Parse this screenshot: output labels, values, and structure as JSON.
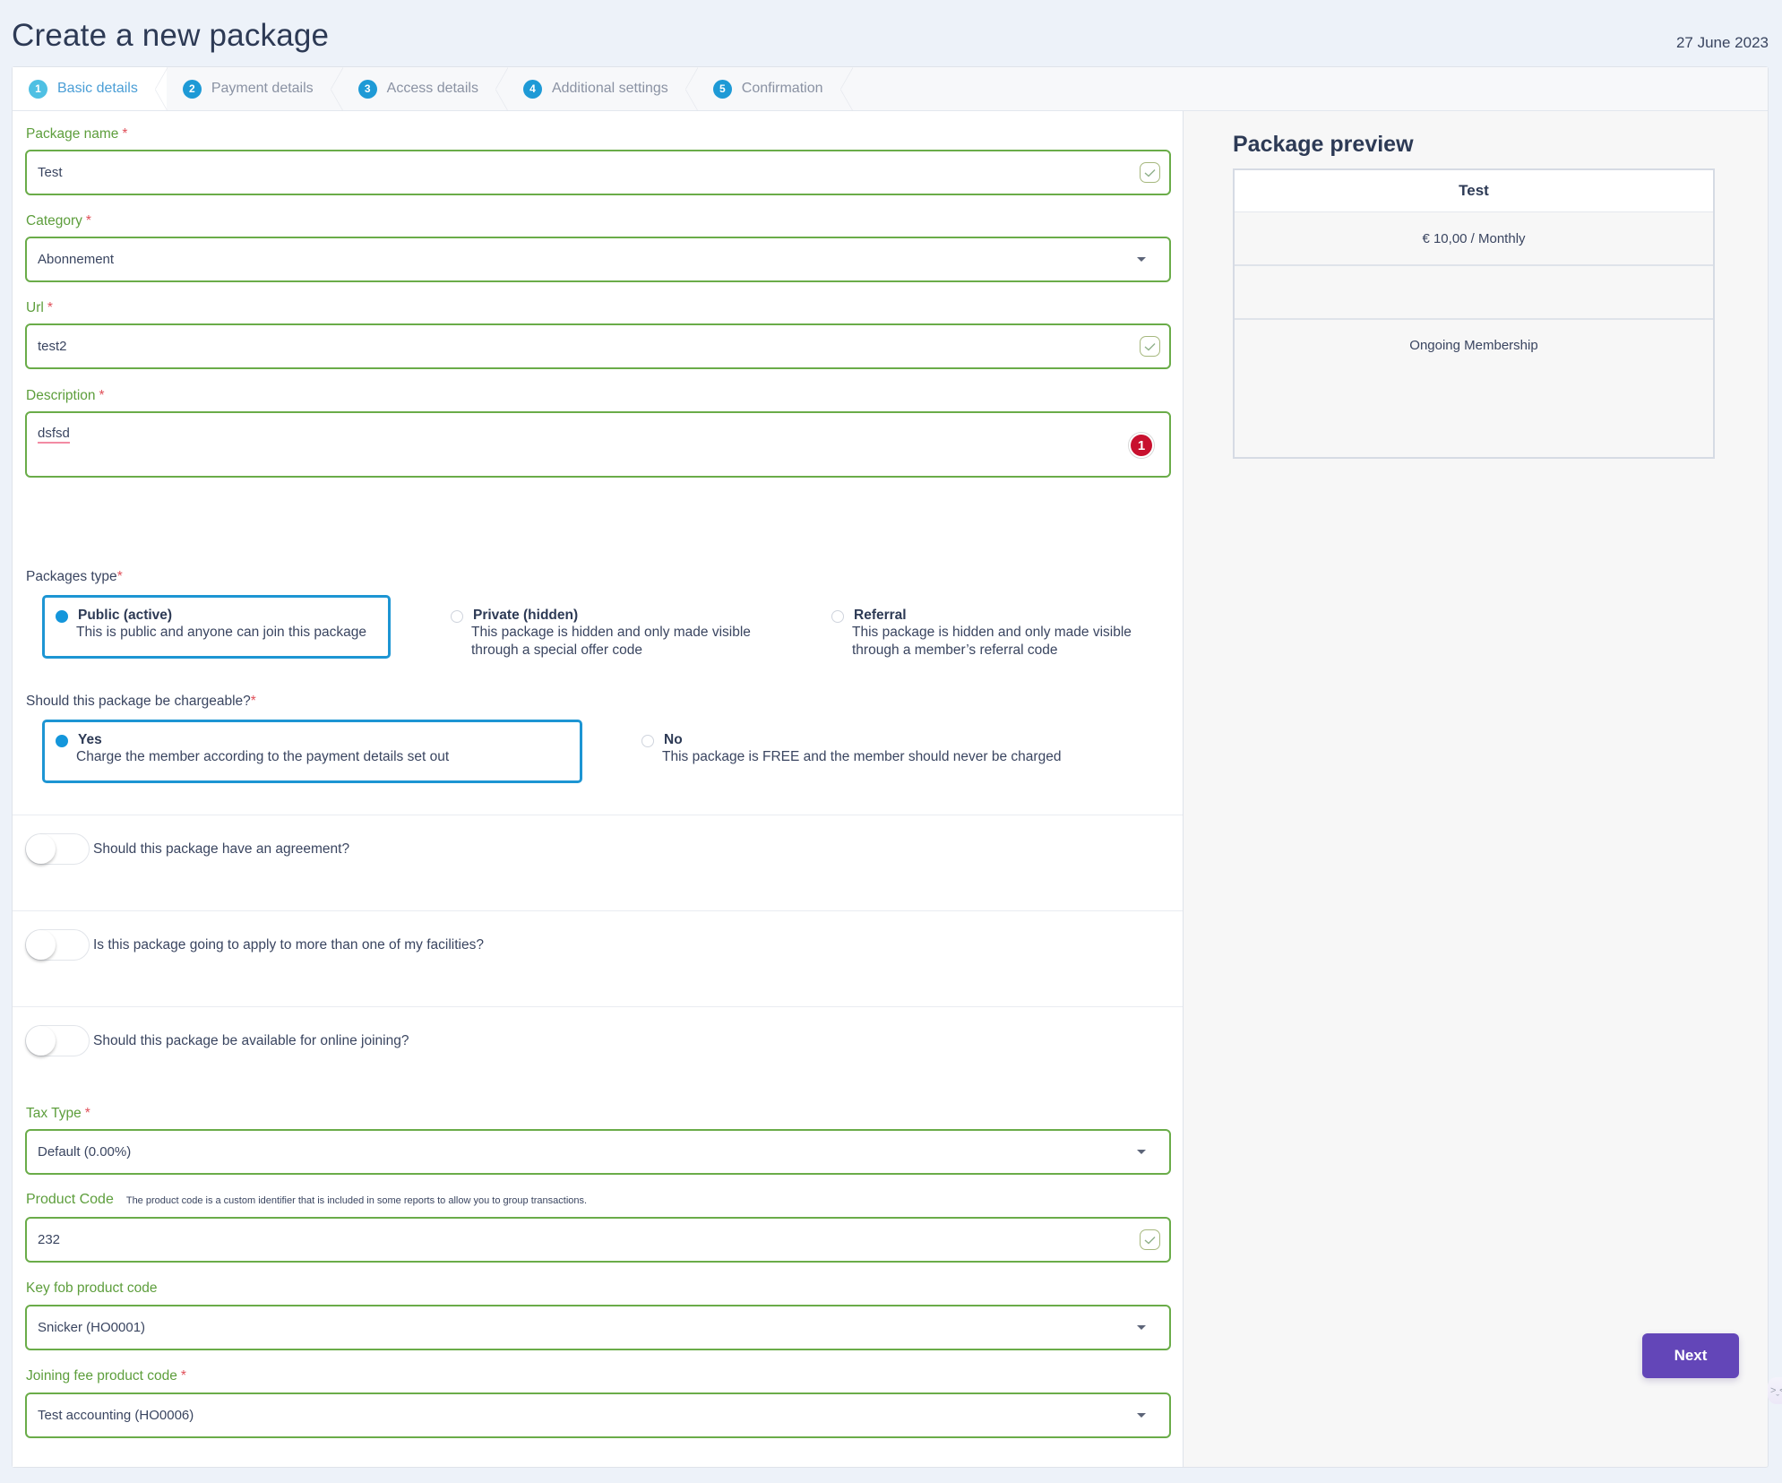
{
  "header": {
    "title": "Create a new package",
    "date": "27 June 2023"
  },
  "stepper": {
    "steps": [
      {
        "number": "1",
        "label": "Basic details",
        "active": true
      },
      {
        "number": "2",
        "label": "Payment details",
        "active": false
      },
      {
        "number": "3",
        "label": "Access details",
        "active": false
      },
      {
        "number": "4",
        "label": "Additional settings",
        "active": false
      },
      {
        "number": "5",
        "label": "Confirmation",
        "active": false
      }
    ]
  },
  "form": {
    "package_name": {
      "label": "Package name",
      "required": "*",
      "value": "Test",
      "status_icon": "check-icon"
    },
    "category": {
      "label": "Category",
      "required": "*",
      "value": "Abonnement",
      "icon": "caret-down-icon"
    },
    "url": {
      "label": "Url",
      "required": "*",
      "value": "test2",
      "status_icon": "check-icon"
    },
    "description": {
      "label": "Description",
      "required": "*",
      "value": "dsfsd",
      "error_count": "1"
    },
    "package_type": {
      "label": "Packages type",
      "required": "*",
      "selected": "public",
      "options": [
        {
          "id": "public",
          "title": "Public (active)",
          "description": "This is public and anyone can join this package"
        },
        {
          "id": "private",
          "title": "Private (hidden)",
          "description_line1": "This package is hidden and only made visible",
          "description_line2": "through a special offer code"
        },
        {
          "id": "referral",
          "title": "Referral",
          "description_line1": "This package is hidden and only made visible",
          "description_line2": "through a member’s referral code"
        }
      ]
    },
    "chargeable": {
      "label": "Should this package be chargeable?",
      "required": "*",
      "selected": "yes",
      "options": [
        {
          "id": "yes",
          "title": "Yes",
          "description": "Charge the member according to the payment details set out"
        },
        {
          "id": "no",
          "title": "No",
          "description": "This package is FREE and the member should never be charged"
        }
      ]
    },
    "toggles": [
      {
        "label": "Should this package have an agreement?",
        "on": false
      },
      {
        "label": "Is this package going to apply to more than one of my facilities?",
        "on": false
      },
      {
        "label": "Should this package be available for online joining?",
        "on": false
      }
    ],
    "tax_type": {
      "label": "Tax Type",
      "required": "*",
      "value": "Default (0.00%)"
    },
    "product_code": {
      "label": "Product Code",
      "hint": "The product code is a custom identifier that is included in some reports to allow you to group transactions.",
      "value": "232"
    },
    "key_fob_product_code": {
      "label": "Key fob product code",
      "value": "Snicker (HO0001)"
    },
    "joining_fee_product_code": {
      "label": "Joining fee product code",
      "required": "*",
      "value": "Test accounting (HO0006)"
    }
  },
  "preview": {
    "title": "Package preview",
    "name": "Test",
    "price": "€ 10,00 / Monthly",
    "extra": "",
    "membership_type": "Ongoing Membership"
  },
  "actions": {
    "next_label": "Next"
  },
  "side_widget": {
    "glyph": ">ˬ<"
  },
  "colors": {
    "accent_blue": "#1e9ad6",
    "valid_green": "#6aac49",
    "required_red": "#e0505a",
    "error_badge": "#c8102e",
    "primary_button": "#6346b8"
  }
}
